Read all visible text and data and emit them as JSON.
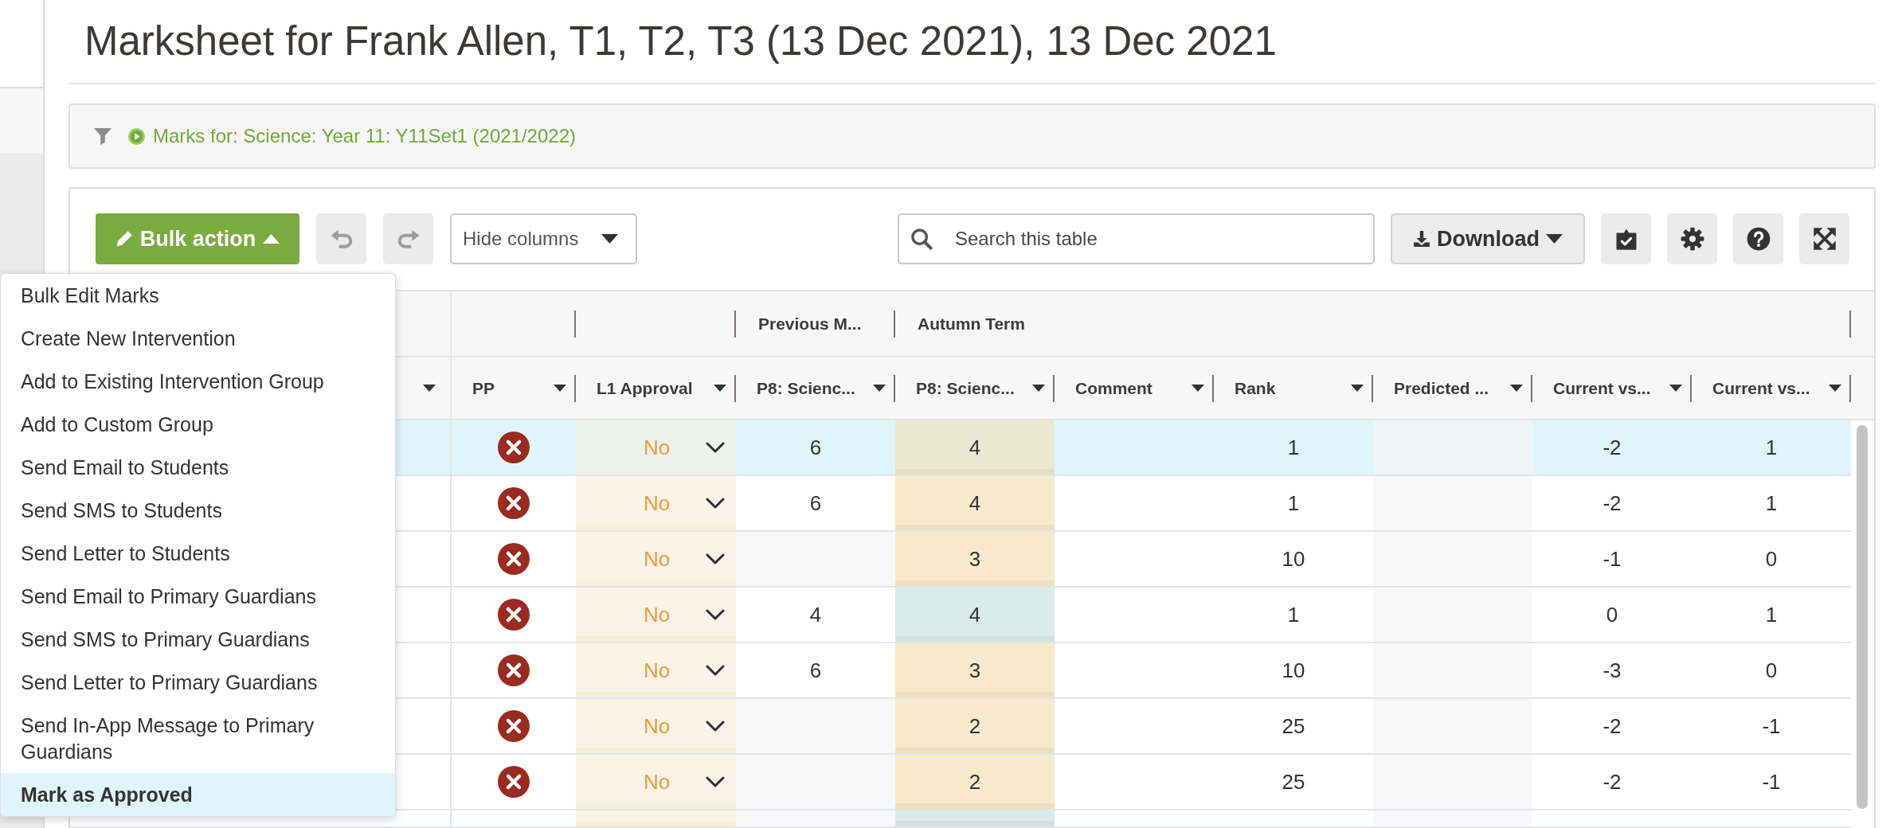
{
  "page": {
    "title": "Marksheet for Frank Allen, T1, T2, T3 (13 Dec 2021), 13 Dec 2021"
  },
  "filter": {
    "text": "Marks for: Science: Year 11: Y11Set1 (2021/2022)"
  },
  "toolbar": {
    "bulk_action": {
      "label": "Bulk action",
      "expanded": true
    },
    "undo": {
      "disabled": true
    },
    "redo": {
      "disabled": true
    },
    "hide_columns": {
      "label": "Hide columns"
    },
    "search": {
      "placeholder": "Search this table"
    },
    "download": {
      "label": "Download"
    }
  },
  "bulk_menu": [
    {
      "label": "Bulk Edit Marks",
      "selected": false
    },
    {
      "label": "Create New Intervention",
      "selected": false
    },
    {
      "label": "Add to Existing Intervention Group",
      "selected": false
    },
    {
      "label": "Add to Custom Group",
      "selected": false
    },
    {
      "label": "Send Email to Students",
      "selected": false
    },
    {
      "label": "Send SMS to Students",
      "selected": false
    },
    {
      "label": "Send Letter to Students",
      "selected": false
    },
    {
      "label": "Send Email to Primary Guardians",
      "selected": false
    },
    {
      "label": "Send SMS to Primary Guardians",
      "selected": false
    },
    {
      "label": "Send Letter to Primary Guardians",
      "selected": false
    },
    {
      "label": "Send In-App Message to Primary Guardians",
      "selected": false
    },
    {
      "label": "Mark as Approved",
      "selected": true
    }
  ],
  "table": {
    "column_groups": [
      {
        "columns": [
          {
            "label": "PP"
          }
        ]
      },
      {
        "columns": [
          {
            "label": "L1 Approval"
          }
        ]
      },
      {
        "label": "Previous M...",
        "columns": [
          {
            "label": "P8: Scienc..."
          }
        ]
      },
      {
        "label": "Autumn Term",
        "columns": [
          {
            "label": "P8: Scienc..."
          },
          {
            "label": "Comment"
          },
          {
            "label": "Rank"
          },
          {
            "label": "Predicted ..."
          },
          {
            "label": "Current vs..."
          },
          {
            "label": "Current vs..."
          }
        ]
      }
    ],
    "rows": [
      {
        "selected": true,
        "pp": false,
        "approval": "No",
        "previous": "6",
        "autumn": {
          "value": "4",
          "color": "#ece8cf"
        },
        "rank": "1",
        "current_vs_1": "-2",
        "current_vs_2": "1"
      },
      {
        "selected": false,
        "pp": false,
        "approval": "No",
        "previous": "6",
        "autumn": {
          "value": "4",
          "color": "#f7e9cb"
        },
        "rank": "1",
        "current_vs_1": "-2",
        "current_vs_2": "1"
      },
      {
        "selected": false,
        "pp": false,
        "approval": "No",
        "autumn": {
          "value": "3",
          "color": "#f7e9cb"
        },
        "rank": "10",
        "current_vs_1": "-1",
        "current_vs_2": "0"
      },
      {
        "selected": false,
        "pp": false,
        "approval": "No",
        "previous": "4",
        "autumn": {
          "value": "4",
          "color": "#d9ecea"
        },
        "rank": "1",
        "current_vs_1": "0",
        "current_vs_2": "1"
      },
      {
        "selected": false,
        "pp": false,
        "approval": "No",
        "previous": "6",
        "autumn": {
          "value": "3",
          "color": "#f7e9cb"
        },
        "rank": "10",
        "current_vs_1": "-3",
        "current_vs_2": "0"
      },
      {
        "selected": false,
        "pp": false,
        "approval": "No",
        "autumn": {
          "value": "2",
          "color": "#f7e9cb"
        },
        "rank": "25",
        "current_vs_1": "-2",
        "current_vs_2": "-1"
      },
      {
        "selected": false,
        "pp": false,
        "approval": "No",
        "autumn": {
          "value": "2",
          "color": "#f7e9cb"
        },
        "rank": "25",
        "current_vs_1": "-2",
        "current_vs_2": "-1"
      },
      {
        "selected": false,
        "autumn": {
          "color": "#d9ecea"
        }
      }
    ]
  }
}
